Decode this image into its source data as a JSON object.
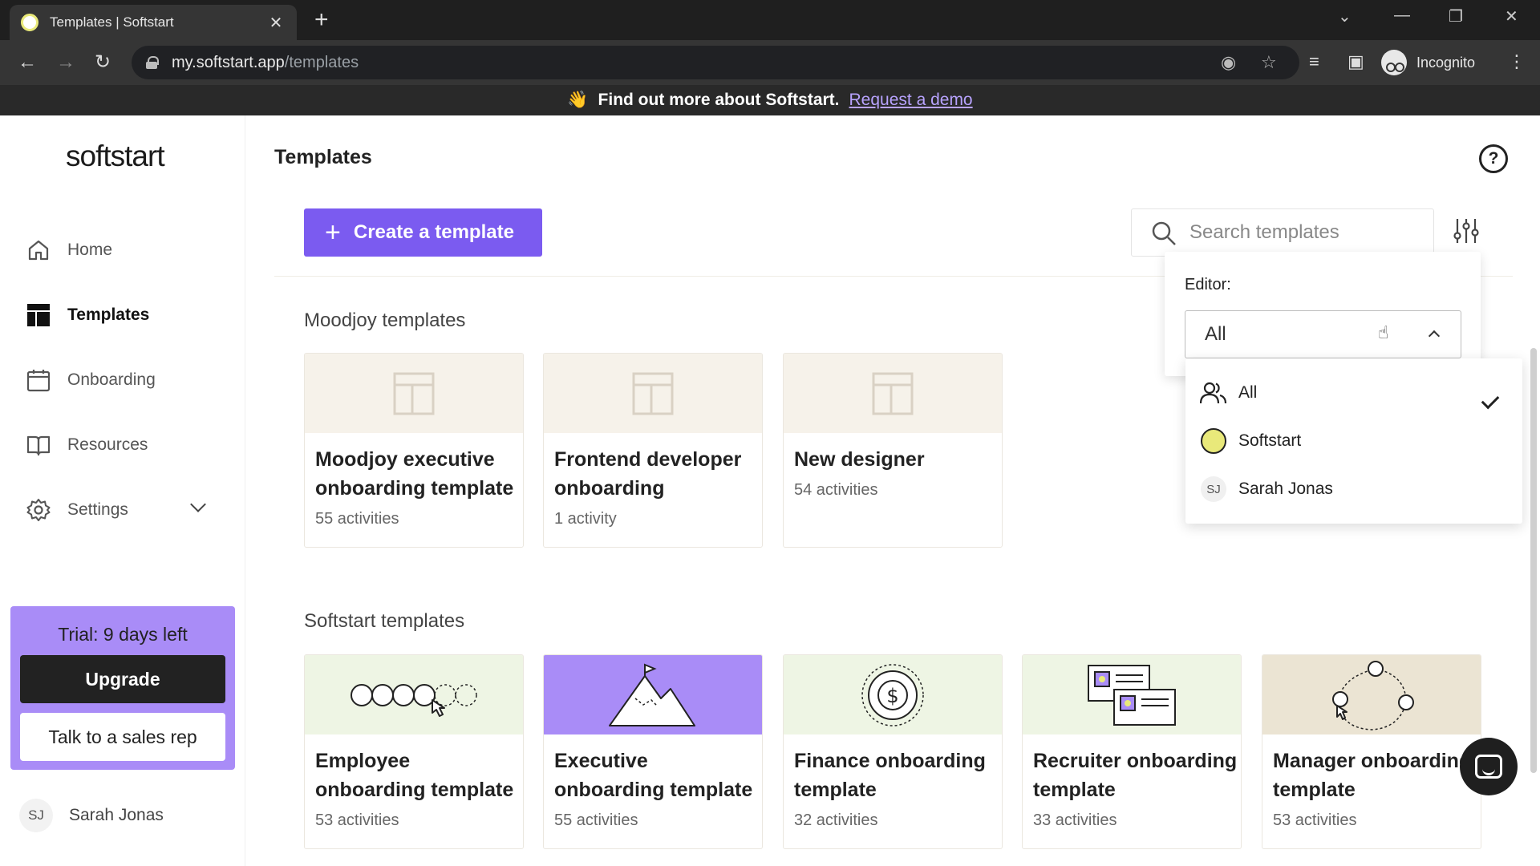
{
  "browser": {
    "tab_title": "Templates | Softstart",
    "url_host": "my.softstart.app",
    "url_path": "/templates",
    "incognito_label": "Incognito"
  },
  "banner": {
    "emoji": "👋",
    "text": "Find out more about Softstart.",
    "link": "Request a demo"
  },
  "sidebar": {
    "logo": "softstart",
    "items": [
      {
        "label": "Home",
        "icon": "home-icon"
      },
      {
        "label": "Templates",
        "icon": "templates-icon",
        "active": true
      },
      {
        "label": "Onboarding",
        "icon": "calendar-icon"
      },
      {
        "label": "Resources",
        "icon": "book-icon"
      },
      {
        "label": "Settings",
        "icon": "gear-icon"
      }
    ],
    "trial": {
      "text": "Trial: 9 days left",
      "upgrade": "Upgrade",
      "sales": "Talk to a sales rep"
    },
    "user": {
      "initials": "SJ",
      "name": "Sarah Jonas"
    }
  },
  "header": {
    "title": "Templates"
  },
  "toolbar": {
    "create_label": "Create a template",
    "search_placeholder": "Search templates"
  },
  "sections": [
    {
      "title": "Moodjoy templates",
      "cards": [
        {
          "title": "Moodjoy executive onboarding template",
          "meta": "55 activities"
        },
        {
          "title": "Frontend developer onboarding",
          "meta": "1 activity"
        },
        {
          "title": "New designer",
          "meta": "54 activities"
        }
      ]
    },
    {
      "title": "Softstart templates",
      "cards": [
        {
          "title": "Employee onboarding template",
          "meta": "53 activities"
        },
        {
          "title": "Executive onboarding template",
          "meta": "55 activities"
        },
        {
          "title": "Finance onboarding template",
          "meta": "32 activities"
        },
        {
          "title": "Recruiter onboarding template",
          "meta": "33 activities"
        },
        {
          "title": "Manager onboarding template",
          "meta": "53 activities"
        }
      ]
    }
  ],
  "filter": {
    "label": "Editor:",
    "selected": "All",
    "options": [
      {
        "label": "All",
        "checked": true
      },
      {
        "label": "Softstart"
      },
      {
        "label": "Sarah Jonas",
        "initials": "SJ"
      }
    ]
  },
  "colors": {
    "accent": "#7b5bf0",
    "trial_bg": "#a98cf7",
    "banner_link": "#b8a3ff"
  }
}
